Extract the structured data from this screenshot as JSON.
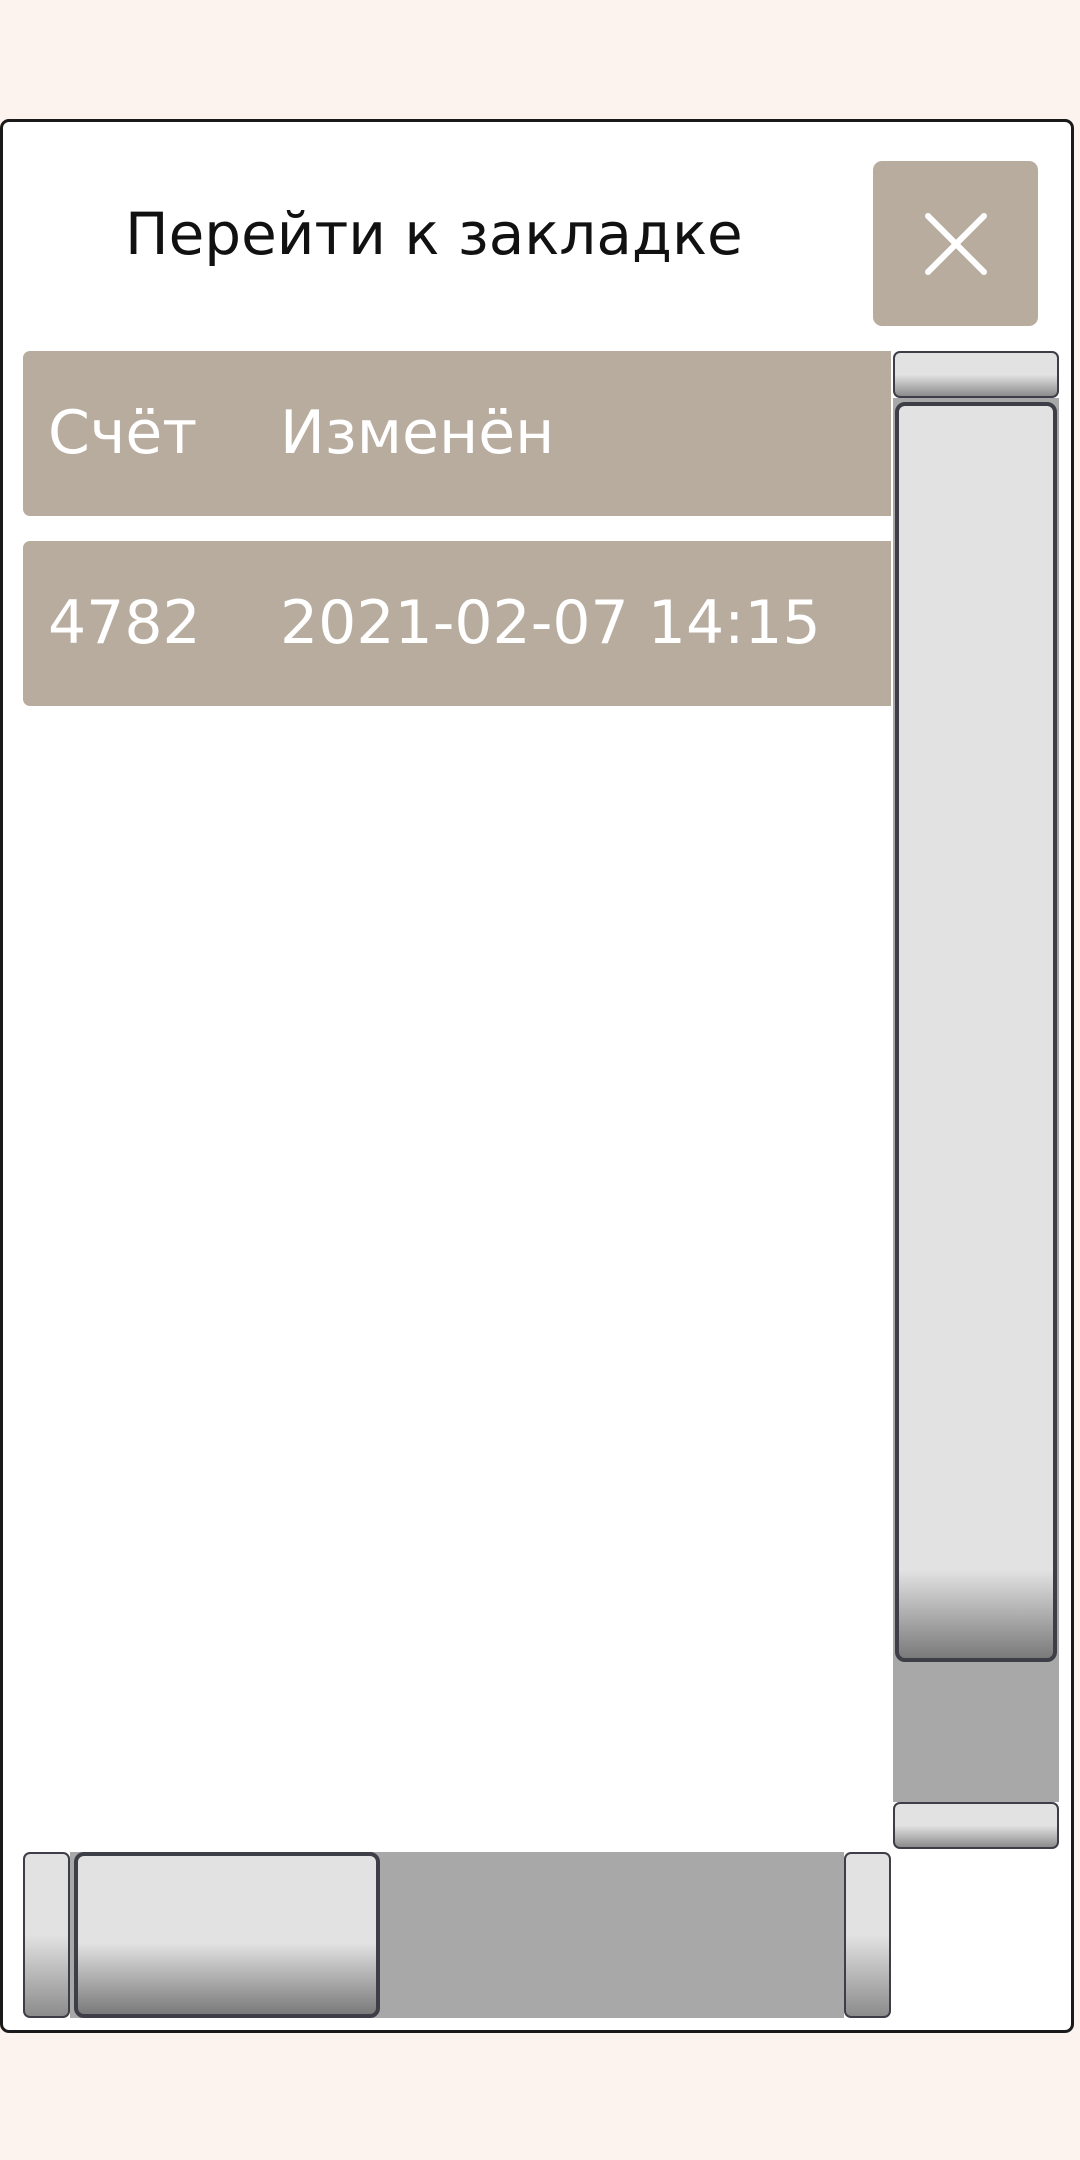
{
  "dialog": {
    "title": "Перейти к закладке",
    "close_icon": "close-icon"
  },
  "table": {
    "columns": [
      "Счёт",
      "Изменён"
    ],
    "rows": [
      [
        "4782",
        "2021-02-07 14:15"
      ]
    ]
  },
  "colors": {
    "background": "#fdf3ee",
    "dialog_bg": "#ffffff",
    "accent": "#b8ac9f",
    "scroll_track": "#a8a8a8",
    "scroll_thumb": "#e2e2e2"
  }
}
